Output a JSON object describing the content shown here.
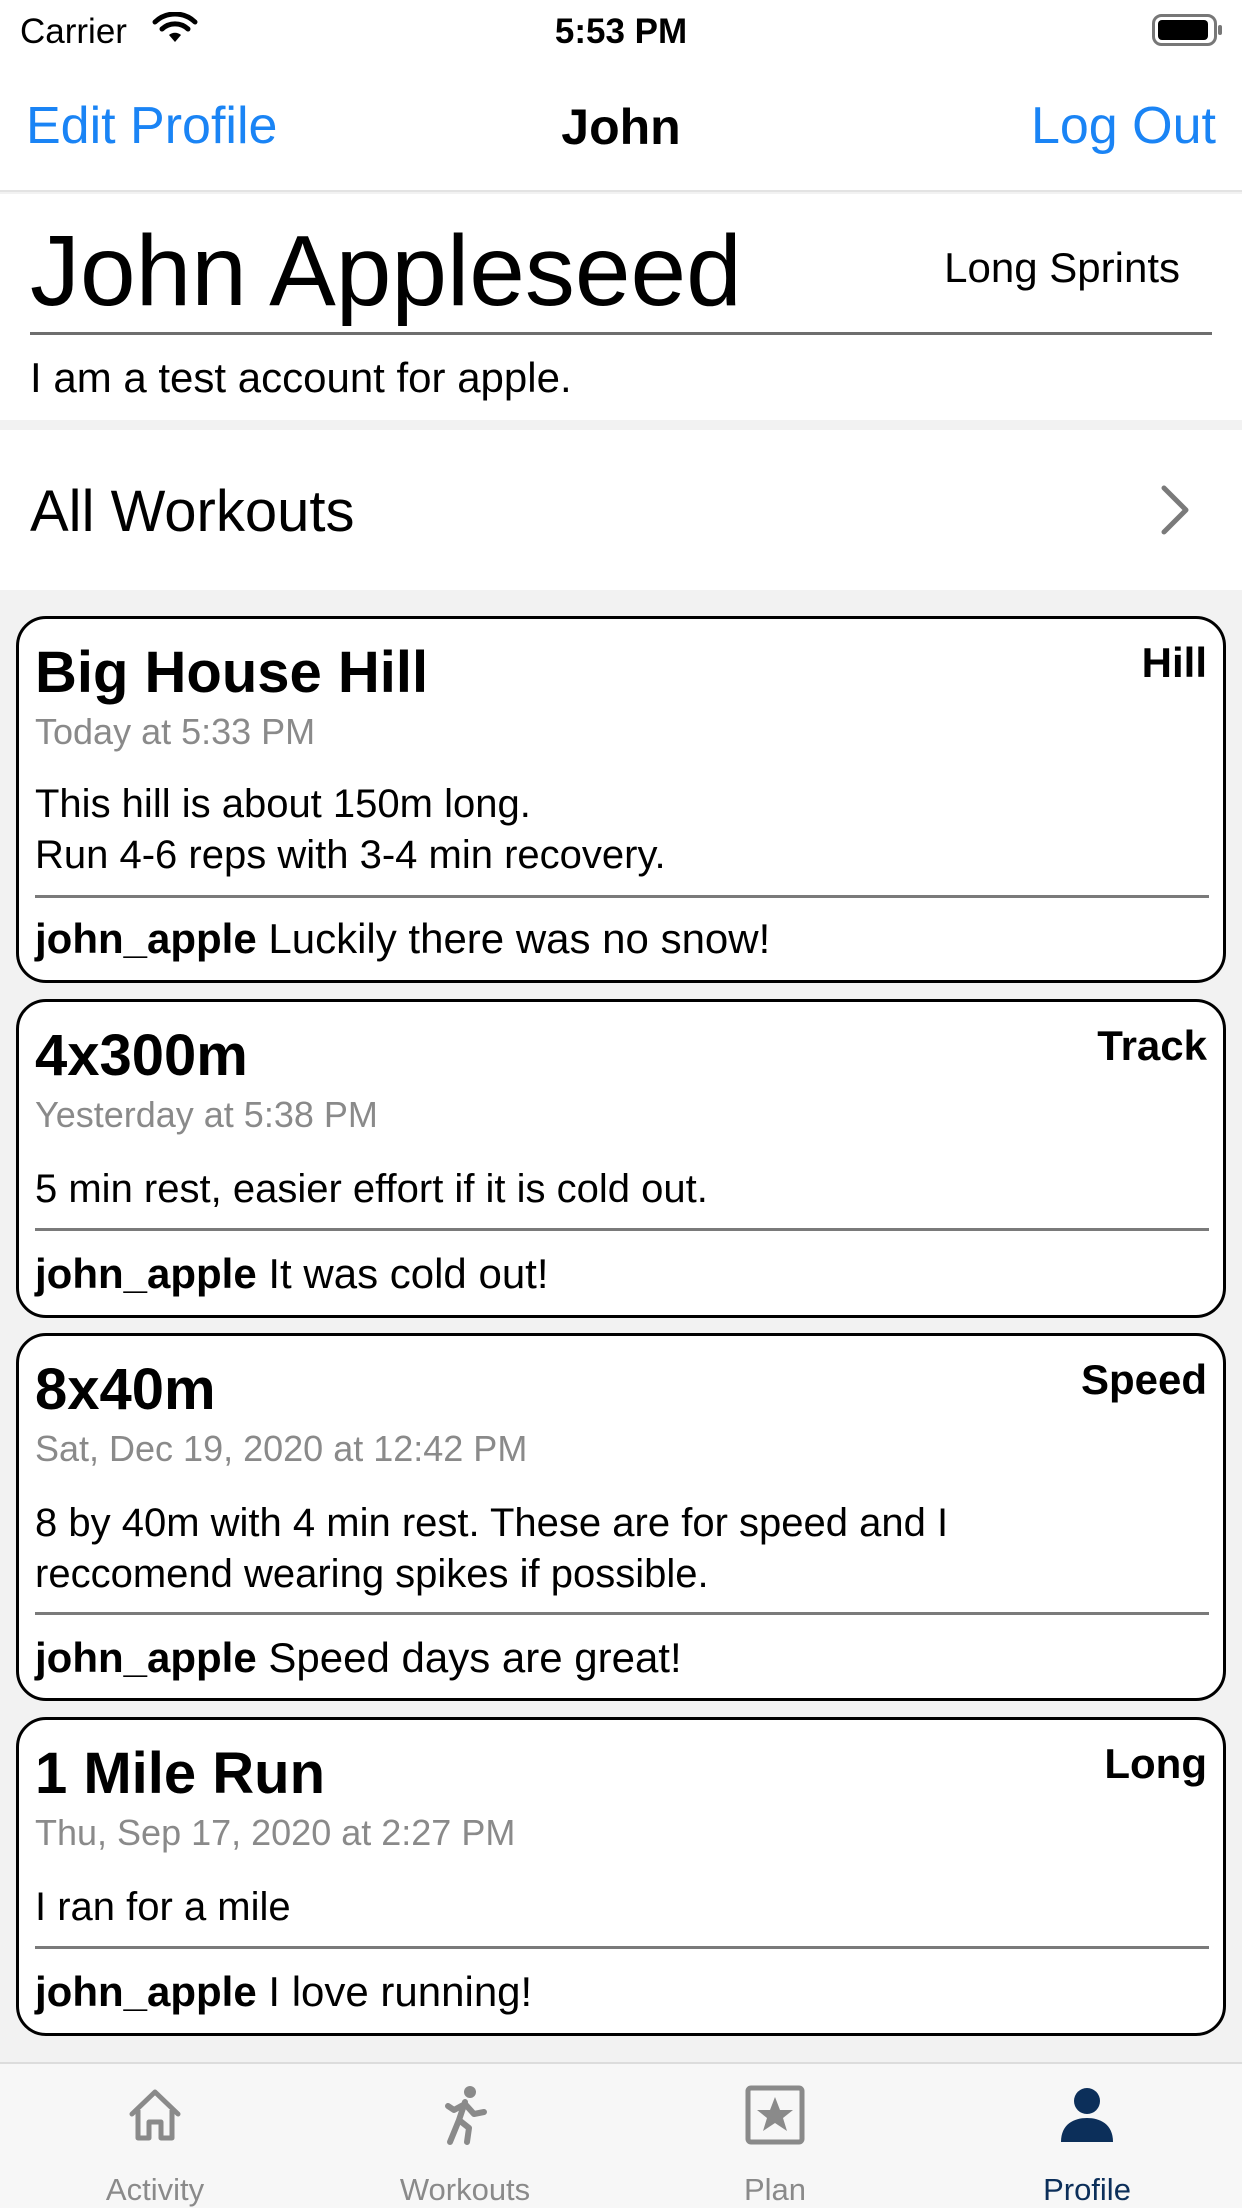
{
  "status_bar": {
    "carrier": "Carrier",
    "time": "5:53 PM"
  },
  "nav": {
    "left_label": "Edit Profile",
    "title": "John",
    "right_label": "Log Out"
  },
  "profile": {
    "name": "John Appleseed",
    "event": "Long Sprints",
    "bio": "I am a test account for apple."
  },
  "all_workouts": {
    "label": "All Workouts"
  },
  "workouts": [
    {
      "title": "Big House Hill",
      "tag": "Hill",
      "date": "Today at 5:33 PM",
      "description_lines": [
        "This hill is about 150m long.",
        "Run 4-6 reps with 3-4 min recovery."
      ],
      "comment_user": "john_apple",
      "comment_text": " Luckily there was no snow!"
    },
    {
      "title": "4x300m",
      "tag": "Track",
      "date": "Yesterday at 5:38 PM",
      "description_lines": [
        "5 min rest, easier effort if it is cold out."
      ],
      "comment_user": "john_apple",
      "comment_text": " It was cold out!"
    },
    {
      "title": "8x40m",
      "tag": "Speed",
      "date": "Sat, Dec 19, 2020 at 12:42 PM",
      "description_lines": [
        "8 by 40m with 4 min rest. These are for speed and I",
        "reccomend wearing spikes if possible."
      ],
      "comment_user": "john_apple",
      "comment_text": " Speed days are great!"
    },
    {
      "title": "1 Mile Run",
      "tag": "Long",
      "date": "Thu, Sep 17, 2020 at 2:27 PM",
      "description_lines": [
        "I ran for a mile"
      ],
      "comment_user": "john_apple",
      "comment_text": " I love running!"
    }
  ],
  "tab_bar": {
    "tabs": [
      {
        "label": "Activity",
        "icon": "house-icon"
      },
      {
        "label": "Workouts",
        "icon": "running-figure-icon"
      },
      {
        "label": "Plan",
        "icon": "star-square-icon"
      },
      {
        "label": "Profile",
        "icon": "person-icon"
      }
    ],
    "active": "Profile"
  },
  "colors": {
    "accent": "#1a84f5",
    "active_tab": "#0c2f5a",
    "inactive_tab": "#8a8a8a",
    "date_gray": "#8a8a8a"
  }
}
